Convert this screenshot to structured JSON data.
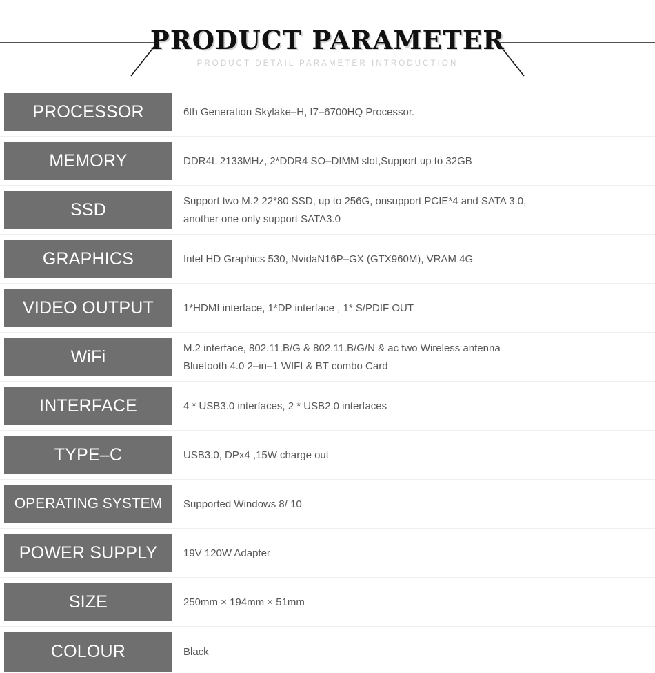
{
  "header": {
    "title": "PRODUCT PARAMETER",
    "subtitle": "PRODUCT DETAIL PARAMETER INTRODUCTION",
    "left_rule_name": "left-decoration-rule",
    "right_rule_name": "right-decoration-rule"
  },
  "colors": {
    "label_bg": "#706f6f",
    "label_text": "#ffffff",
    "value_text": "#555555",
    "row_divider": "#efefef",
    "subtitle": "#cfcfcf",
    "title": "#111111",
    "page_bg": "#ffffff"
  },
  "table": {
    "rows": [
      {
        "label": "PROCESSOR",
        "lines": [
          "6th Generation Skylake–H, I7–6700HQ Processor."
        ]
      },
      {
        "label": "MEMORY",
        "lines": [
          "DDR4L 2133MHz, 2*DDR4 SO–DIMM slot,Support up to 32GB"
        ]
      },
      {
        "label": "SSD",
        "lines": [
          "Support two M.2 22*80 SSD, up to 256G, onsupport PCIE*4 and SATA 3.0,",
          "another one only support  SATA3.0"
        ]
      },
      {
        "label": "GRAPHICS",
        "lines": [
          "Intel HD Graphics 530,  NvidaN16P–GX (GTX960M), VRAM 4G"
        ]
      },
      {
        "label": "VIDEO OUTPUT",
        "lines": [
          "1*HDMI interface, 1*DP interface , 1* S/PDIF OUT"
        ]
      },
      {
        "label": "WiFi",
        "lines": [
          "M.2 interface, 802.11.B/G & 802.11.B/G/N & ac two Wireless antenna",
          "Bluetooth 4.0 2–in–1 WIFI & BT combo Card"
        ]
      },
      {
        "label": "INTERFACE",
        "lines": [
          "4 * USB3.0 interfaces, 2 * USB2.0 interfaces"
        ]
      },
      {
        "label": "TYPE–C",
        "lines": [
          "USB3.0, DPx4 ,15W charge out"
        ]
      },
      {
        "label": "OPERATING SYSTEM",
        "lines": [
          "Supported Windows 8/ 10"
        ]
      },
      {
        "label": "POWER SUPPLY",
        "lines": [
          "19V 120W Adapter"
        ]
      },
      {
        "label": "SIZE",
        "lines": [
          "250mm × 194mm × 51mm"
        ]
      },
      {
        "label": "COLOUR",
        "lines": [
          "Black"
        ]
      }
    ]
  }
}
